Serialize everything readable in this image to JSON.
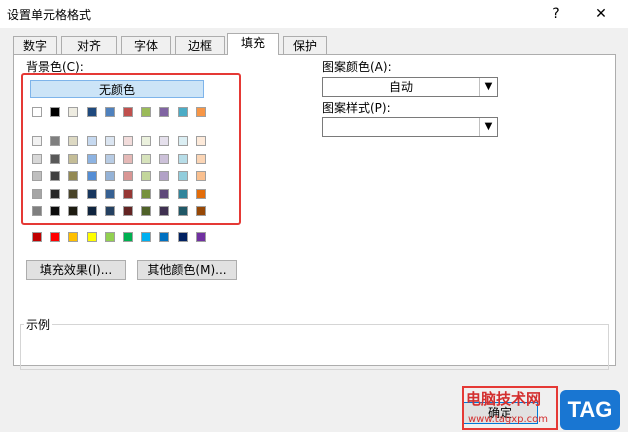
{
  "window": {
    "title": "设置单元格格式",
    "help_glyph": "?",
    "close_glyph": "✕"
  },
  "tabs": [
    "数字",
    "对齐",
    "字体",
    "边框",
    "填充",
    "保护"
  ],
  "active_tab": "填充",
  "fill": {
    "background_label": "背景色(C):",
    "no_color_label": "无颜色",
    "pattern_color_label": "图案颜色(A):",
    "pattern_color_value": "自动",
    "pattern_style_label": "图案样式(P):",
    "pattern_style_value": "",
    "fill_effects_button": "填充效果(I)...",
    "more_colors_button": "其他颜色(M)...",
    "sample_label": "示例",
    "ok_button": "确定"
  },
  "palette": {
    "theme_top": [
      "#ffffff",
      "#000000",
      "#eeece1",
      "#1f497d",
      "#4f81bd",
      "#c0504d",
      "#9bbb59",
      "#8064a2",
      "#4bacc6",
      "#f79646"
    ],
    "theme_shades": [
      [
        "#f2f2f2",
        "#7f7f7f",
        "#ddd9c3",
        "#c6d9f0",
        "#dbe5f1",
        "#f2dcdb",
        "#ebf1dd",
        "#e5e0ec",
        "#dbeef3",
        "#fdeada"
      ],
      [
        "#d8d8d8",
        "#595959",
        "#c4bd97",
        "#8db3e2",
        "#b8cce4",
        "#e5b9b7",
        "#d7e3bc",
        "#ccc1d9",
        "#b7dde8",
        "#fbd5b5"
      ],
      [
        "#bfbfbf",
        "#3f3f3f",
        "#938953",
        "#548dd4",
        "#95b3d7",
        "#d99694",
        "#c3d69b",
        "#b2a2c7",
        "#92cddc",
        "#fac08f"
      ],
      [
        "#a5a5a5",
        "#262626",
        "#494429",
        "#17365d",
        "#366092",
        "#953734",
        "#76923c",
        "#5f497a",
        "#31859b",
        "#e36c09"
      ],
      [
        "#7f7f7f",
        "#0c0c0c",
        "#1d1b10",
        "#0f243e",
        "#244061",
        "#632423",
        "#4f6128",
        "#3f3151",
        "#205867",
        "#974806"
      ]
    ],
    "standard": [
      "#c00000",
      "#ff0000",
      "#ffc000",
      "#ffff00",
      "#92d050",
      "#00b050",
      "#00b0f0",
      "#0070c0",
      "#002060",
      "#7030a0"
    ]
  },
  "watermark": {
    "site": "电脑技术网",
    "url": "www.tagxp.com",
    "tag": "TAG"
  }
}
